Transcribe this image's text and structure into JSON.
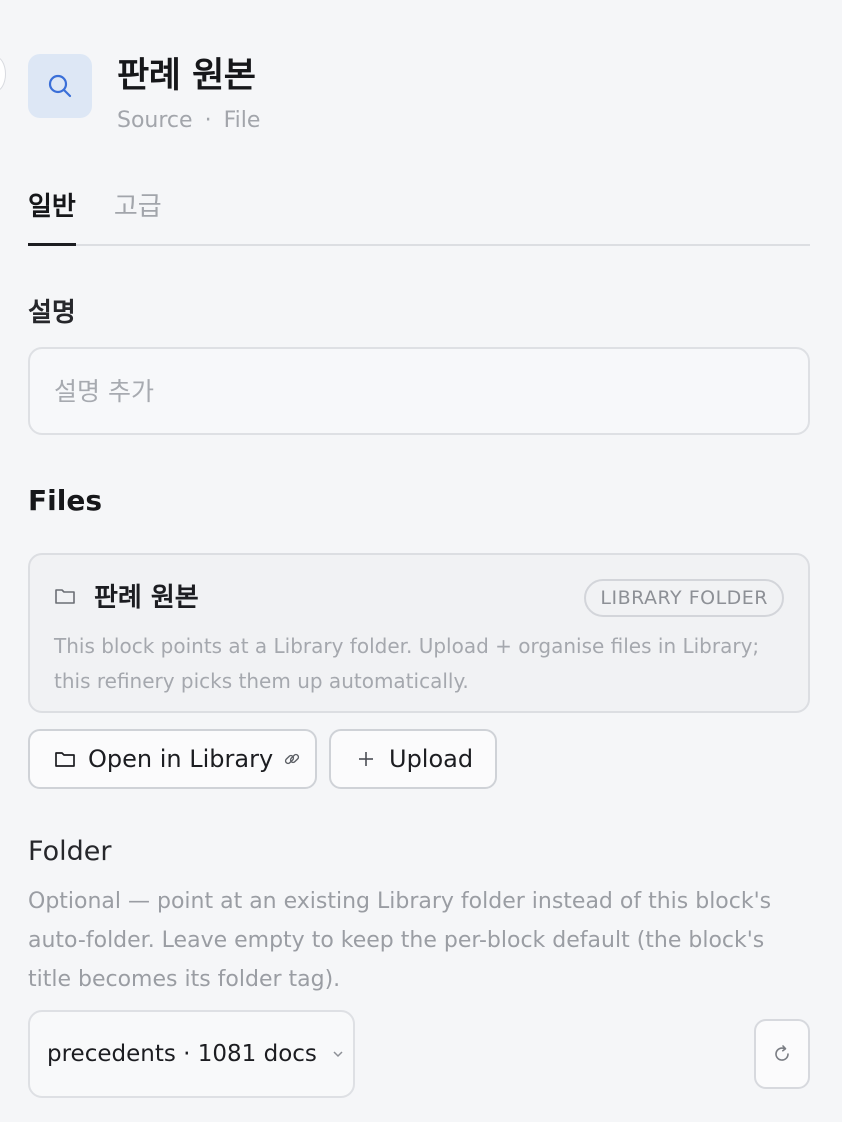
{
  "header": {
    "title": "판례 원본",
    "subtitle_type": "Source",
    "subtitle_separator": "·",
    "subtitle_kind": "File",
    "icon": "search-icon"
  },
  "tabs": [
    {
      "label": "일반",
      "active": true
    },
    {
      "label": "고급",
      "active": false
    }
  ],
  "description": {
    "label": "설명",
    "placeholder": "설명 추가",
    "value": ""
  },
  "files": {
    "heading": "Files",
    "folder_name": "판례 원본",
    "badge": "LIBRARY FOLDER",
    "note": "This block points at a Library folder. Upload + organise files in Library; this refinery picks them up automatically.",
    "open_button": "Open in Library",
    "upload_button": "Upload"
  },
  "folder": {
    "heading": "Folder",
    "help": "Optional — point at an existing Library folder instead of this block's auto-folder. Leave empty to keep the per-block default (the block's title becomes its folder tag).",
    "selected": "precedents · 1081 docs"
  },
  "colors": {
    "accent": "#3a6fd8",
    "icon_tile": "#dde7f5",
    "background": "#f5f6f8"
  }
}
